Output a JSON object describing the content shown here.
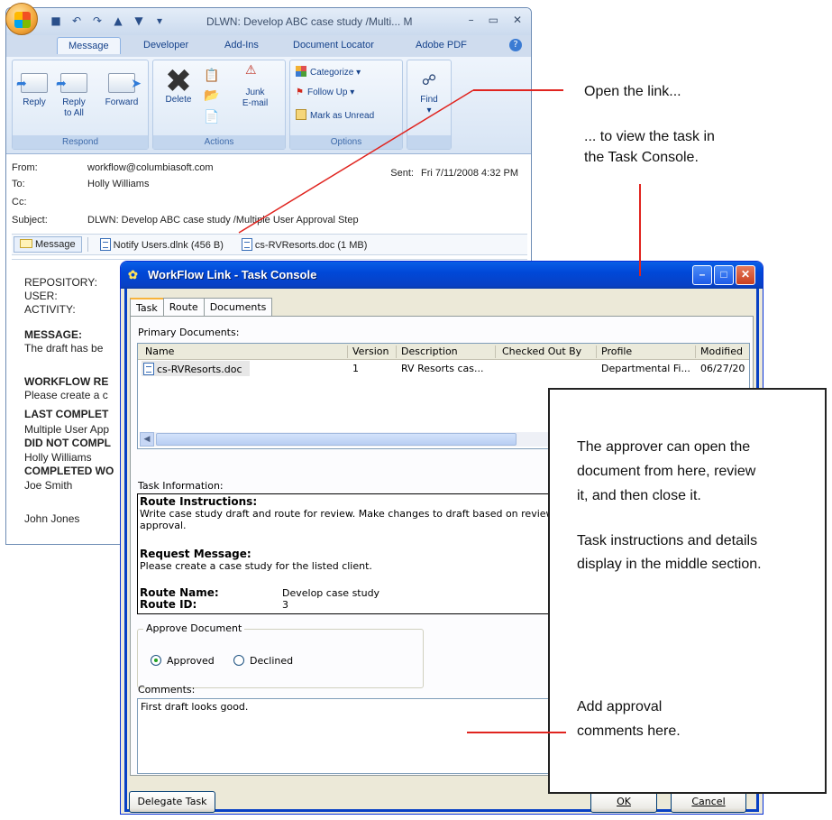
{
  "outlook": {
    "title": "DLWN: Develop  ABC case study /Multi... M",
    "tabs": [
      "Message",
      "Developer",
      "Add-Ins",
      "Document Locator",
      "Adobe PDF"
    ],
    "ribbon": {
      "respond_label": "Respond",
      "actions_label": "Actions",
      "options_label": "Options",
      "reply": "Reply",
      "reply_all_1": "Reply",
      "reply_all_2": "to All",
      "forward": "Forward",
      "delete": "Delete",
      "junk_1": "Junk",
      "junk_2": "E-mail",
      "categorize": "Categorize",
      "follow_up": "Follow Up",
      "mark_unread": "Mark as Unread",
      "find": "Find"
    },
    "header": {
      "from_label": "From:",
      "from": "workflow@columbiasoft.com",
      "to_label": "To:",
      "to": "Holly Williams",
      "cc_label": "Cc:",
      "subject_label": "Subject:",
      "subject": "DLWN: Develop  ABC case study /Multiple User Approval Step",
      "sent_label": "Sent:",
      "sent": "Fri 7/11/2008 4:32 PM"
    },
    "attachments": [
      "Message",
      "Notify Users.dlnk (456 B)",
      "cs-RVResorts.doc (1 MB)"
    ],
    "body": {
      "repository": "REPOSITORY:",
      "user": "USER:",
      "activity": "ACTIVITY:",
      "message_h": "MESSAGE:",
      "message": "The draft has be",
      "workflow_h": "WORKFLOW RE",
      "workflow": "Please create a c",
      "last_h": "LAST COMPLET",
      "last": "Multiple User App",
      "didnot_h": "DID NOT COMPL",
      "didnot": "Holly Williams",
      "completed_h": "COMPLETED WO",
      "completed_1": "Joe Smith",
      "completed_2": "John Jones"
    }
  },
  "console": {
    "title": "WorkFlow Link - Task Console",
    "tabs": [
      "Task",
      "Route",
      "Documents"
    ],
    "primary_docs_label": "Primary Documents:",
    "columns": [
      "Name",
      "Version",
      "Description",
      "Checked Out By",
      "Profile",
      "Modified"
    ],
    "rows": [
      {
        "name": "cs-RVResorts.doc",
        "version": "1",
        "description": "RV Resorts cas...",
        "checked_out_by": "",
        "profile": "Departmental Fi...",
        "modified": "06/27/20"
      }
    ],
    "task_info_label": "Task Information:",
    "route_instructions_h": "Route Instructions:",
    "route_instructions_1": "Write case study draft and route for review. Make changes to draft based on reviewe",
    "route_instructions_2": "approval.",
    "request_message_h": "Request Message:",
    "request_message": "Please create a case study for the listed client.",
    "route_name_label": "Route Name:",
    "route_name": "Develop case study",
    "route_id_label": "Route ID:",
    "route_id": "3",
    "approve_group": "Approve Document",
    "approved": "Approved",
    "declined": "Declined",
    "approve_state": "Approved",
    "comments_label": "Comments:",
    "comments": "First draft looks good.",
    "delegate": "Delegate Task",
    "ok": "OK",
    "cancel": "Cancel"
  },
  "annotations": {
    "open_link": "Open the link...",
    "view_task_1": "... to view the task in",
    "view_task_2": "the Task Console.",
    "approver_1": "The approver can open the",
    "approver_2": "document from here, review",
    "approver_3": "it, and then close it.",
    "instructions_1": "Task instructions and details",
    "instructions_2": "display in the middle section.",
    "comments_1": "Add approval",
    "comments_2": "comments here."
  },
  "colors": {
    "annotation_line": "#e0241f",
    "xp_title": "#0a5fe6",
    "office_ribbon": "#d7e4f4"
  }
}
